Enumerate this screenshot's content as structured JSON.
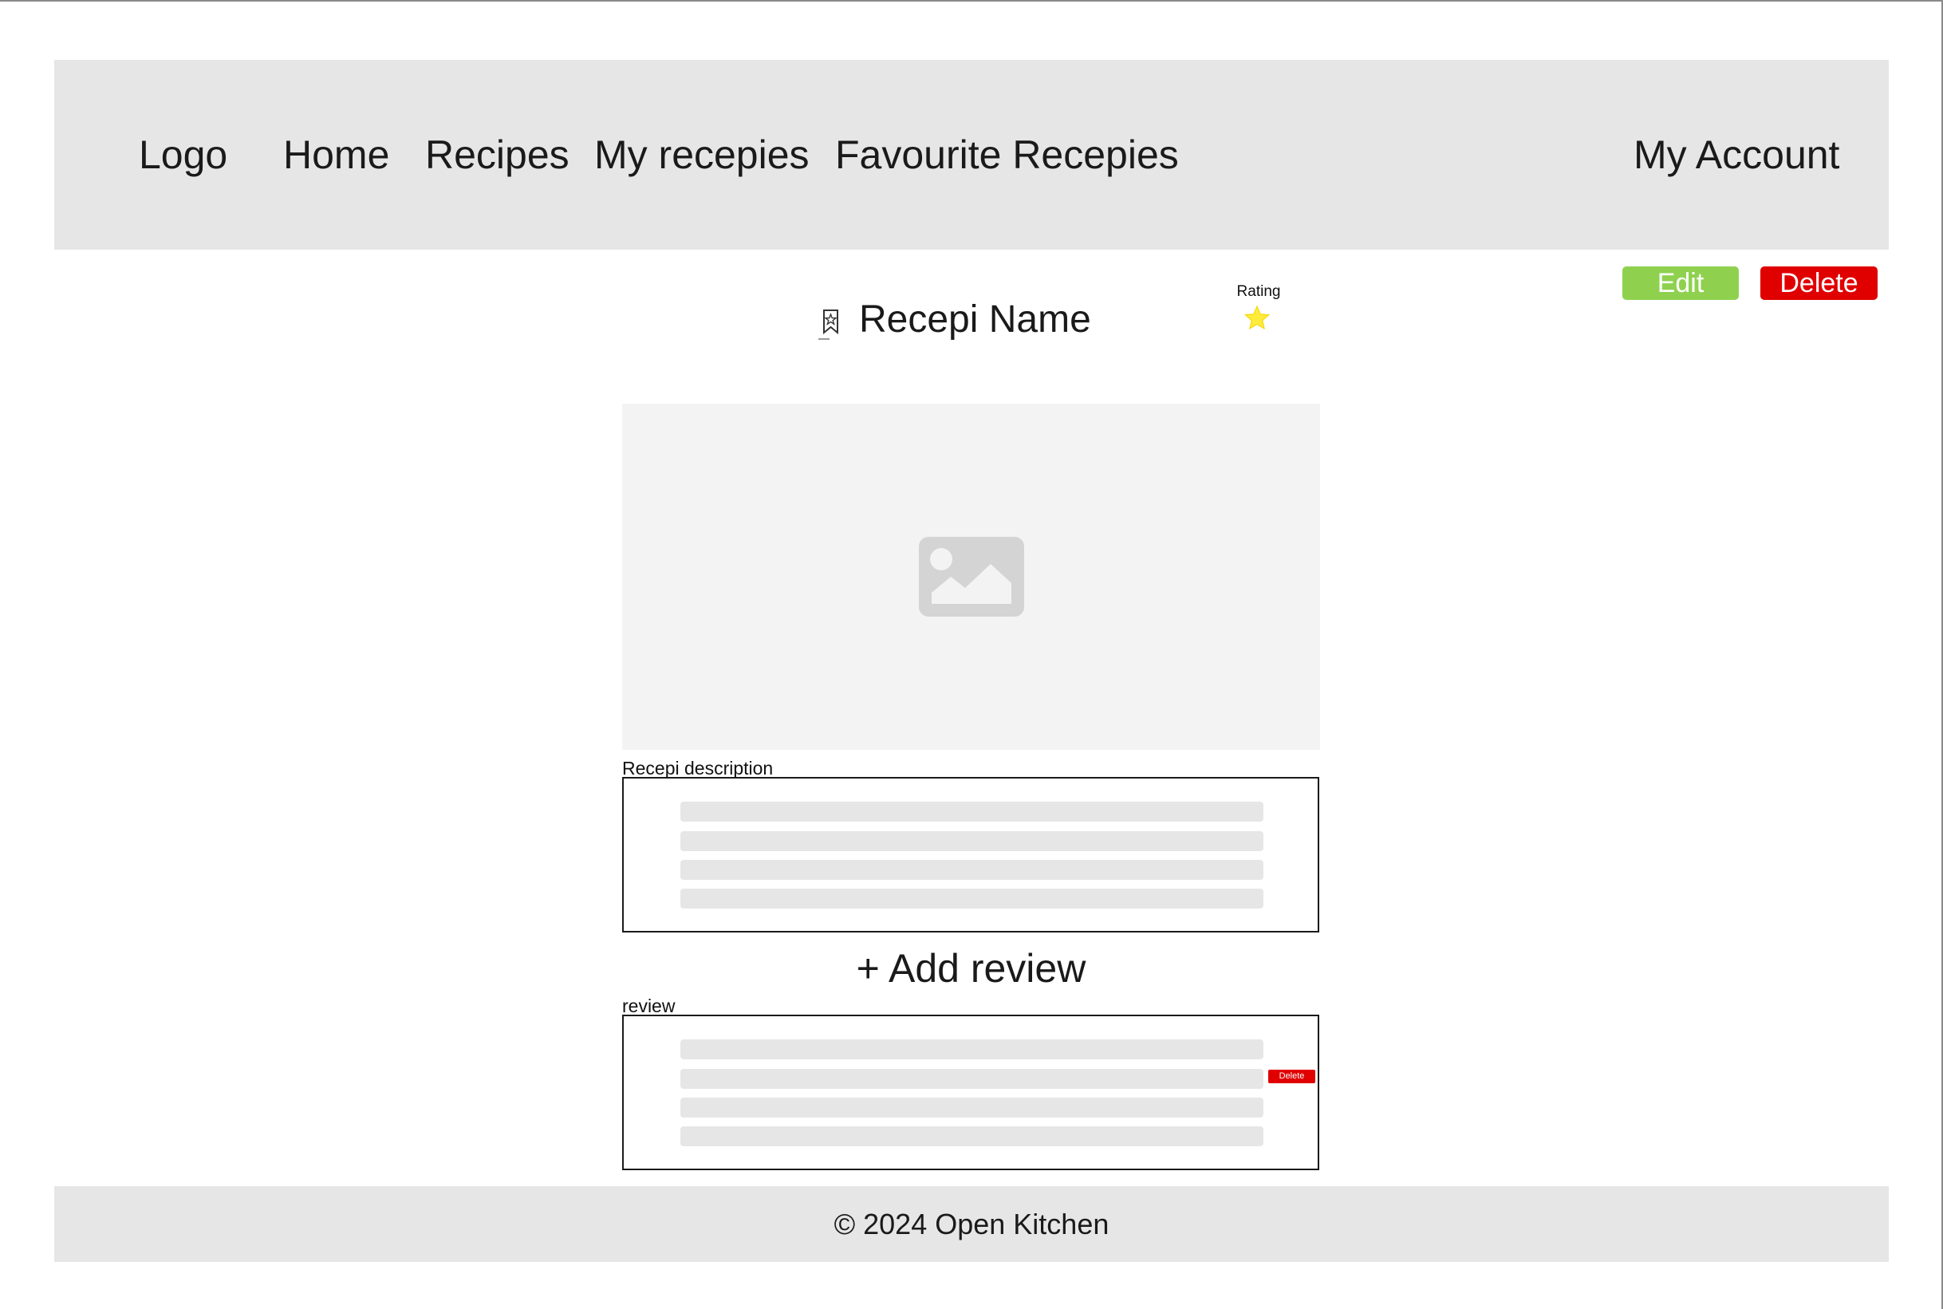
{
  "nav": {
    "logo": "Logo",
    "links": [
      "Home",
      "Recipes",
      "My recepies",
      "Favourite Recepies"
    ],
    "account": "My Account"
  },
  "actions": {
    "edit_label": "Edit",
    "delete_label": "Delete"
  },
  "recipe": {
    "name": "Recepi Name",
    "rating_label": "Rating",
    "bookmark_icon": "bookmark-star-icon",
    "rating_icon": "star-icon",
    "image_icon": "image-placeholder-icon",
    "description_label": "Recepi description"
  },
  "reviews": {
    "add_label": "+ Add review",
    "section_label": "review",
    "delete_label": "Delete"
  },
  "footer": {
    "text": "© 2024 Open Kitchen"
  },
  "colors": {
    "edit": "#8fd14f",
    "delete": "#e00000",
    "nav_bg": "#e6e6e6",
    "star": "#ffeb3b"
  }
}
